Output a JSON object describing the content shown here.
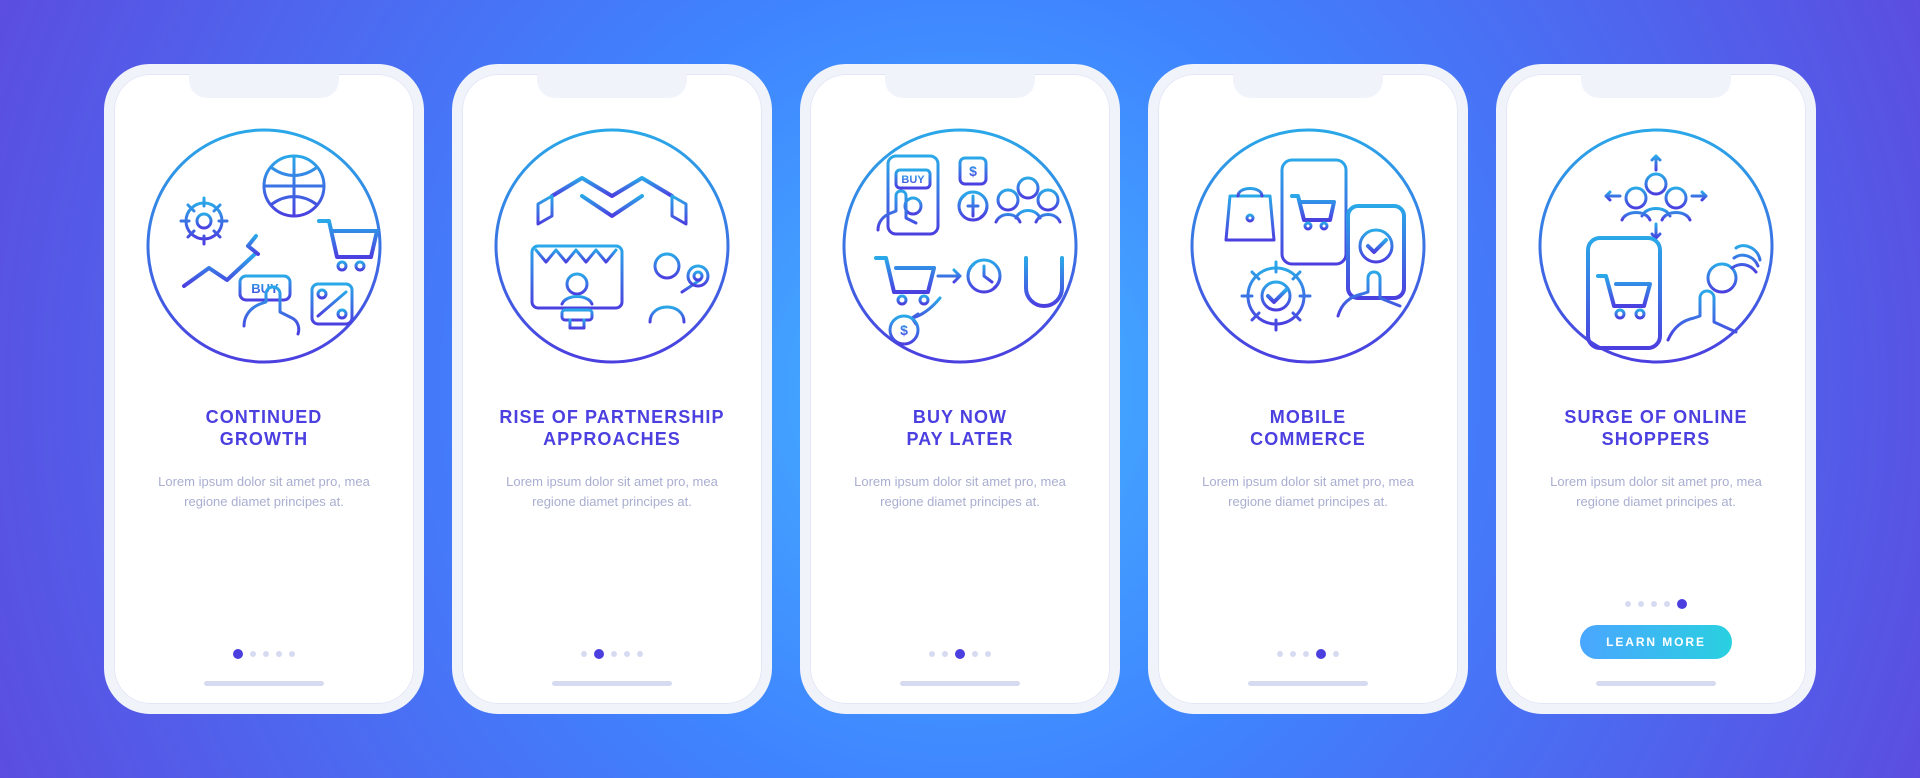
{
  "theme": {
    "bg_gradient": [
      "#45b3ff",
      "#3f84ff",
      "#5b4de0"
    ],
    "accent": "#4b3fe0",
    "cta_gradient": [
      "#4aa6ff",
      "#29d0e0"
    ]
  },
  "screens": [
    {
      "icon": "continued-growth-icon",
      "title": "CONTINUED\nGROWTH",
      "desc": "Lorem ipsum dolor sit amet pro, mea regione diamet principes at.",
      "activeDot": 0,
      "hasCta": false
    },
    {
      "icon": "rise-partnership-icon",
      "title": "RISE OF PARTNERSHIP\nAPPROACHES",
      "desc": "Lorem ipsum dolor sit amet pro, mea regione diamet principes at.",
      "activeDot": 1,
      "hasCta": false
    },
    {
      "icon": "buy-now-pay-later-icon",
      "title": "BUY NOW\nPAY LATER",
      "desc": "Lorem ipsum dolor sit amet pro, mea regione diamet principes at.",
      "activeDot": 2,
      "hasCta": false
    },
    {
      "icon": "mobile-commerce-icon",
      "title": "MOBILE\nCOMMERCE",
      "desc": "Lorem ipsum dolor sit amet pro, mea regione diamet principes at.",
      "activeDot": 3,
      "hasCta": false
    },
    {
      "icon": "surge-online-shoppers-icon",
      "title": "SURGE OF ONLINE\nSHOPPERS",
      "desc": "Lorem ipsum dolor sit amet pro, mea regione diamet principes at.",
      "activeDot": 4,
      "hasCta": true
    }
  ],
  "dotsCount": 5,
  "cta_label": "LEARN MORE"
}
